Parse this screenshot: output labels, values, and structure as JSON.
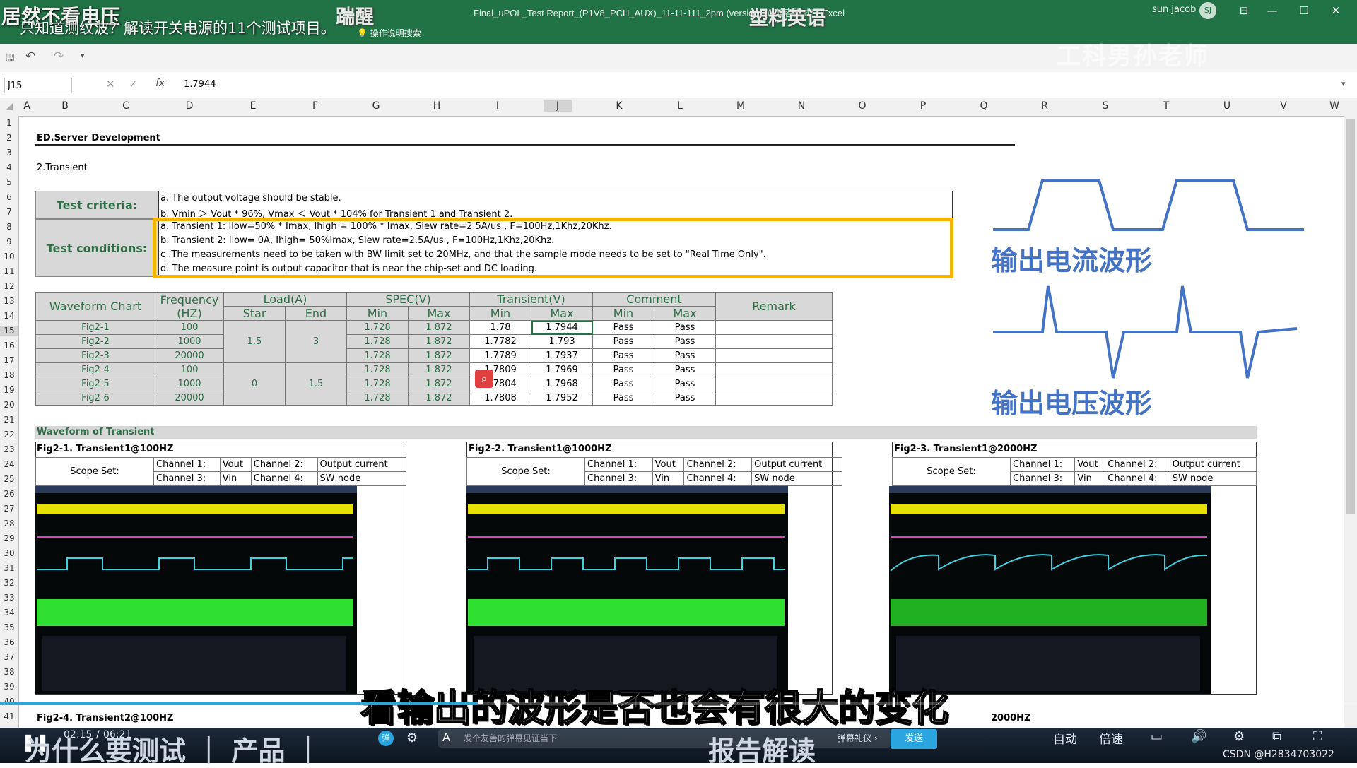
{
  "window": {
    "title": "Final_uPOL_Test Report_(P1V8_PCH_AUX)_11-11-111_2pm (version 1)  [兼容模式]  -  Excel",
    "user": "sun jacob",
    "user_initials": "SJ",
    "tell_me": "操作说明搜索",
    "controls": [
      "⊟",
      "—",
      "☐",
      "✕"
    ]
  },
  "overlay": {
    "title_left": "居然不看电压",
    "subtitle_left": "只知道测纹波？解读开关电源的11个测试项目。",
    "top_mid": "踹醒",
    "top_mid2": "塑料英语",
    "watermark": "工科男孙老师",
    "subtitle_main": "看输出的波形是否也会有很大的变化",
    "bottom_left": "为什么要测试   ｜   产品   ｜",
    "bottom_mid": "报告解读"
  },
  "formula_bar": {
    "name_box": "J15",
    "fx_label": "fx",
    "value": "1.7944"
  },
  "columns": [
    "A",
    "B",
    "C",
    "D",
    "E",
    "F",
    "G",
    "H",
    "I",
    "J",
    "K",
    "L",
    "M",
    "N",
    "O",
    "P",
    "Q",
    "R",
    "S",
    "T",
    "U",
    "V",
    "W"
  ],
  "rows": [
    "1",
    "2",
    "3",
    "4",
    "5",
    "6",
    "7",
    "8",
    "9",
    "10",
    "11",
    "12",
    "13",
    "14",
    "15",
    "16",
    "17",
    "18",
    "19",
    "20",
    "21",
    "22",
    "23",
    "24",
    "25",
    "26",
    "27",
    "28",
    "29",
    "30",
    "31",
    "32",
    "33",
    "34",
    "35",
    "36",
    "37",
    "38",
    "39",
    "40",
    "41"
  ],
  "sheet": {
    "heading": "ED.Server Development",
    "section": "2.Transient",
    "criteria_label": "Test criteria:",
    "criteria": [
      "a. The output voltage should be stable.",
      "b. Vmin ＞ Vout * 96%, Vmax ＜ Vout * 104% for Transient 1 and Transient 2."
    ],
    "conditions_label": "Test conditions:",
    "conditions": [
      "a. Transient 1: Ilow=50% * Imax,  Ihigh = 100% * Imax, Slew rate=2.5A/us , F=100Hz,1Khz,20Khz.",
      "b. Transient 2: Ilow= 0A,  Ihigh= 50%Imax, Slew rate=2.5A/us ,  F=100Hz,1Khz,20Khz.",
      "c .The measurements need to be taken with BW limit set to 20MHz, and that the sample mode needs to be set to \"Real Time Only\".",
      "d. The measure point is output capacitor that is near the chip-set and DC loading."
    ],
    "table": {
      "h_waveform": "Waveform Chart",
      "h_freq": "Frequency (HZ)",
      "h_load": "Load(A)",
      "h_star": "Star",
      "h_end": "End",
      "h_spec": "SPEC(V)",
      "h_transient": "Transient(V)",
      "h_comment": "Comment",
      "h_min": "Min",
      "h_max": "Max",
      "h_remark": "Remark",
      "rows": [
        {
          "fig": "Fig2-1",
          "freq": "100",
          "smin": "1.728",
          "smax": "1.872",
          "tmin": "1.78",
          "tmax": "1.7944",
          "cmin": "Pass",
          "cmax": "Pass"
        },
        {
          "fig": "Fig2-2",
          "freq": "1000",
          "smin": "1.728",
          "smax": "1.872",
          "tmin": "1.7782",
          "tmax": "1.793",
          "cmin": "Pass",
          "cmax": "Pass"
        },
        {
          "fig": "Fig2-3",
          "freq": "20000",
          "smin": "1.728",
          "smax": "1.872",
          "tmin": "1.7789",
          "tmax": "1.7937",
          "cmin": "Pass",
          "cmax": "Pass"
        },
        {
          "fig": "Fig2-4",
          "freq": "100",
          "smin": "1.728",
          "smax": "1.872",
          "tmin": "1.7809",
          "tmax": "1.7969",
          "cmin": "Pass",
          "cmax": "Pass"
        },
        {
          "fig": "Fig2-5",
          "freq": "1000",
          "smin": "1.728",
          "smax": "1.872",
          "tmin": "1.7804",
          "tmax": "1.7968",
          "cmin": "Pass",
          "cmax": "Pass"
        },
        {
          "fig": "Fig2-6",
          "freq": "20000",
          "smin": "1.728",
          "smax": "1.872",
          "tmin": "1.7808",
          "tmax": "1.7952",
          "cmin": "Pass",
          "cmax": "Pass"
        }
      ],
      "load_a_start": "1.5",
      "load_a_end": "3",
      "load_b_start": "0",
      "load_b_end": "1.5"
    },
    "waveform_section": "Waveform of Transient",
    "figures": [
      {
        "title": "Fig2-1. Transient1@100HZ"
      },
      {
        "title": "Fig2-2. Transient1@1000HZ"
      },
      {
        "title": "Fig2-3. Transient1@2000HZ"
      }
    ],
    "fig_next": "Fig2-4. Transient2@100HZ",
    "fig_next_right": "2000HZ",
    "scope": {
      "label": "Scope Set:",
      "ch1": "Channel 1:",
      "ch1v": "Vout",
      "ch2": "Channel 2:",
      "ch2v": "Output current",
      "ch3": "Channel 3:",
      "ch3v": "Vin",
      "ch4": "Channel 4:",
      "ch4v": "SW node"
    }
  },
  "diagram": {
    "current_label": "输出电流波形",
    "voltage_label": "输出电压波形",
    "color": "#4472c4"
  },
  "video": {
    "time_current": "02:15",
    "time_total": "06:21",
    "danmaku_placeholder": "发个友善的弹幕见证当下",
    "gift": "弹幕礼仪 ›",
    "send": "发送",
    "auto": "自动",
    "speed": "倍速",
    "credit": "CSDN @H2834703022"
  },
  "colors": {
    "excel_green": "#217346",
    "highlight": "#f5b400",
    "accent": "#4472c4"
  }
}
